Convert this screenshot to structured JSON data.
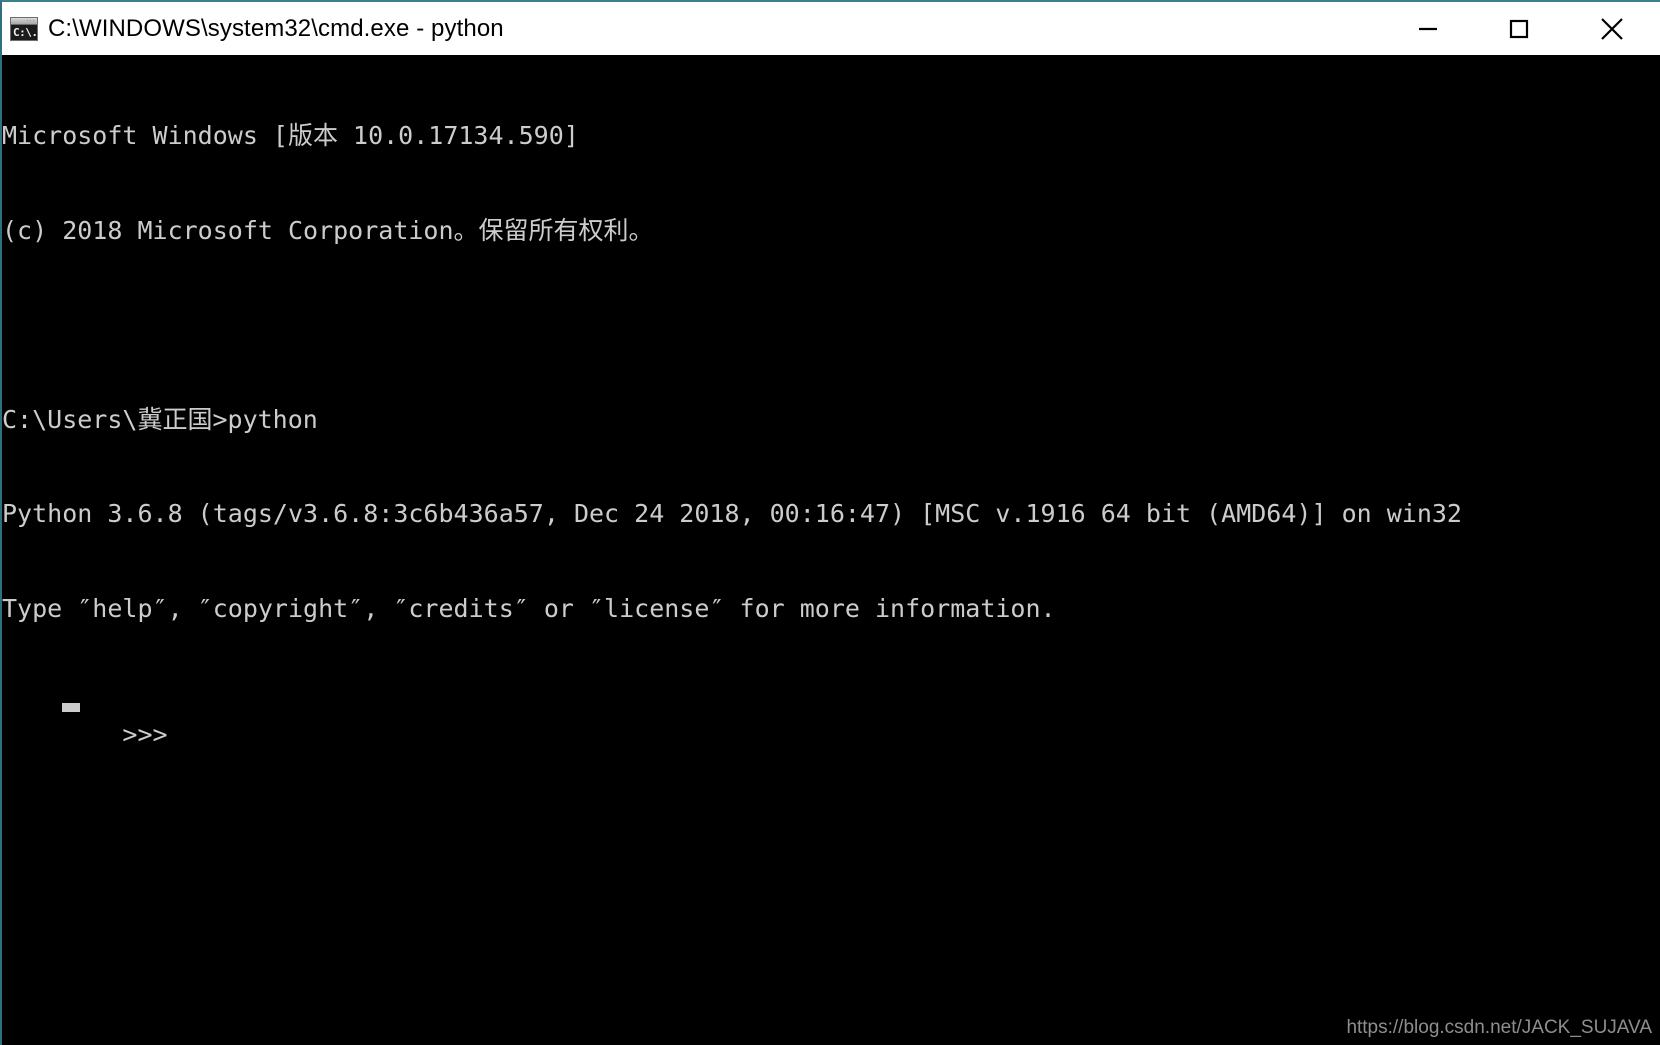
{
  "window": {
    "title": "C:\\WINDOWS\\system32\\cmd.exe - python",
    "icon_name": "cmd-console-icon",
    "icon_glyph": "C:\\.",
    "titlebar_bg": "#ffffff",
    "titlebar_fg": "#000000",
    "border_color": "#3d7f8c",
    "console_bg": "#000000",
    "console_fg": "#cccccc"
  },
  "controls": {
    "minimize_label": "Minimize",
    "maximize_label": "Maximize",
    "close_label": "Close"
  },
  "console": {
    "lines": [
      "Microsoft Windows [版本 10.0.17134.590]",
      "(c) 2018 Microsoft Corporation。保留所有权利。",
      "",
      "C:\\Users\\冀正国>python",
      "Python 3.6.8 (tags/v3.6.8:3c6b436a57, Dec 24 2018, 00:16:47) [MSC v.1916 64 bit (AMD64)] on win32",
      "Type ″help″, ″copyright″, ″credits″ or ″license″ for more information."
    ],
    "prompt": ">>> ",
    "cursor": "block"
  },
  "watermark": {
    "text": "https://blog.csdn.net/JACK_SUJAVA"
  }
}
